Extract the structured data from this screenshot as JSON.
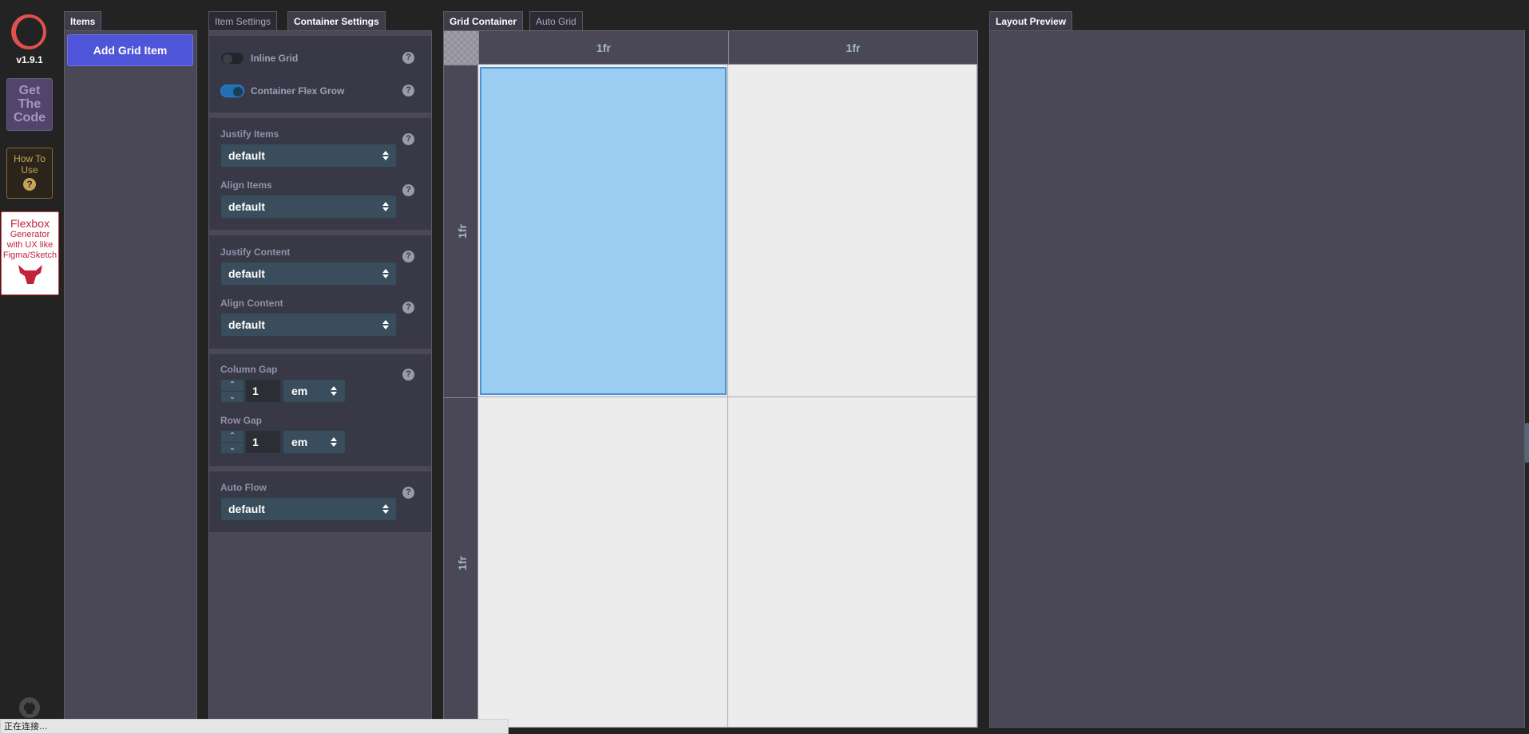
{
  "app": {
    "version": "v1.9.1",
    "get_code_label": "Get The Code",
    "how_to_use_label": "How To Use",
    "how_to_use_icon": "?",
    "flexbox_ad_title": "Flexbox",
    "flexbox_ad_subtitle": "Generator with UX like Figma/Sketch",
    "logo_color": "#e0524f"
  },
  "items_panel": {
    "tab_label": "Items",
    "add_button_label": "Add Grid Item",
    "accent_color": "#4e55d8"
  },
  "settings_panel": {
    "tabs": [
      {
        "label": "Item Settings",
        "active": false
      },
      {
        "label": "Container Settings",
        "active": true
      }
    ],
    "inline_grid": {
      "label": "Inline Grid",
      "enabled": false
    },
    "container_flex_grow": {
      "label": "Container Flex Grow",
      "enabled": true
    },
    "justify_items": {
      "label": "Justify Items",
      "value": "default"
    },
    "align_items": {
      "label": "Align Items",
      "value": "default"
    },
    "justify_content": {
      "label": "Justify Content",
      "value": "default"
    },
    "align_content": {
      "label": "Align Content",
      "value": "default"
    },
    "column_gap": {
      "label": "Column Gap",
      "value": "1",
      "unit": "em"
    },
    "row_gap": {
      "label": "Row Gap",
      "value": "1",
      "unit": "em"
    },
    "auto_flow": {
      "label": "Auto Flow",
      "value": "default"
    },
    "help_icon": "?"
  },
  "grid_panel": {
    "tabs": [
      {
        "label": "Grid Container",
        "active": true
      },
      {
        "label": "Auto Grid",
        "active": false
      }
    ],
    "columns": [
      "1fr",
      "1fr"
    ],
    "rows": [
      "1fr",
      "1fr"
    ],
    "selected_item_color": "#9bcdf2"
  },
  "preview_panel": {
    "tab_label": "Layout Preview"
  },
  "status_bar": {
    "text": "正在连接..."
  }
}
